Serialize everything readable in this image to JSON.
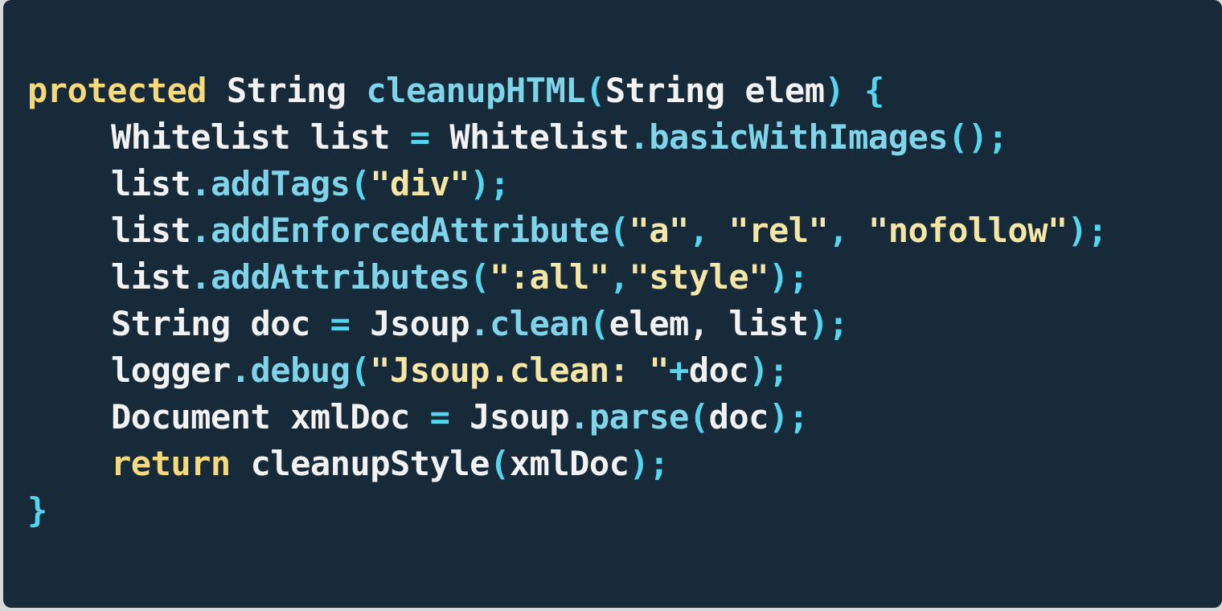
{
  "lines": [
    {
      "indent": false,
      "tokens": [
        {
          "t": "protected",
          "c": "kw"
        },
        {
          "t": " String ",
          "c": "plain"
        },
        {
          "t": "cleanupHTML",
          "c": "fn"
        },
        {
          "t": "(",
          "c": "punc"
        },
        {
          "t": "String elem",
          "c": "plain"
        },
        {
          "t": ") {",
          "c": "punc"
        }
      ]
    },
    {
      "indent": true,
      "tokens": [
        {
          "t": "Whitelist list ",
          "c": "plain"
        },
        {
          "t": "=",
          "c": "op"
        },
        {
          "t": " Whitelist",
          "c": "plain"
        },
        {
          "t": ".basicWithImages",
          "c": "fn"
        },
        {
          "t": "();",
          "c": "punc"
        }
      ]
    },
    {
      "indent": true,
      "tokens": [
        {
          "t": "list",
          "c": "plain"
        },
        {
          "t": ".addTags",
          "c": "fn"
        },
        {
          "t": "(",
          "c": "punc"
        },
        {
          "t": "\"div\"",
          "c": "str"
        },
        {
          "t": ");",
          "c": "punc"
        }
      ]
    },
    {
      "indent": true,
      "tokens": [
        {
          "t": "list",
          "c": "plain"
        },
        {
          "t": ".addEnforcedAttribute",
          "c": "fn"
        },
        {
          "t": "(",
          "c": "punc"
        },
        {
          "t": "\"a\"",
          "c": "str"
        },
        {
          "t": ", ",
          "c": "punc"
        },
        {
          "t": "\"rel\"",
          "c": "str"
        },
        {
          "t": ", ",
          "c": "punc"
        },
        {
          "t": "\"nofollow\"",
          "c": "str"
        },
        {
          "t": ");",
          "c": "punc"
        }
      ]
    },
    {
      "indent": true,
      "tokens": [
        {
          "t": "list",
          "c": "plain"
        },
        {
          "t": ".addAttributes",
          "c": "fn"
        },
        {
          "t": "(",
          "c": "punc"
        },
        {
          "t": "\":all\"",
          "c": "str"
        },
        {
          "t": ",",
          "c": "punc"
        },
        {
          "t": "\"style\"",
          "c": "str"
        },
        {
          "t": ");",
          "c": "punc"
        }
      ]
    },
    {
      "indent": true,
      "tokens": [
        {
          "t": "String doc ",
          "c": "plain"
        },
        {
          "t": "=",
          "c": "op"
        },
        {
          "t": " Jsoup",
          "c": "plain"
        },
        {
          "t": ".clean",
          "c": "fn"
        },
        {
          "t": "(",
          "c": "punc"
        },
        {
          "t": "elem, list",
          "c": "plain"
        },
        {
          "t": ");",
          "c": "punc"
        }
      ]
    },
    {
      "indent": true,
      "tokens": [
        {
          "t": "logger",
          "c": "plain"
        },
        {
          "t": ".debug",
          "c": "fn"
        },
        {
          "t": "(",
          "c": "punc"
        },
        {
          "t": "\"Jsoup.clean: \"",
          "c": "str"
        },
        {
          "t": "+",
          "c": "op"
        },
        {
          "t": "doc",
          "c": "plain"
        },
        {
          "t": ");",
          "c": "punc"
        }
      ]
    },
    {
      "indent": true,
      "tokens": [
        {
          "t": "Document xmlDoc ",
          "c": "plain"
        },
        {
          "t": "=",
          "c": "op"
        },
        {
          "t": " Jsoup",
          "c": "plain"
        },
        {
          "t": ".parse",
          "c": "fn"
        },
        {
          "t": "(",
          "c": "punc"
        },
        {
          "t": "doc",
          "c": "plain"
        },
        {
          "t": ");",
          "c": "punc"
        }
      ]
    },
    {
      "indent": true,
      "tokens": [
        {
          "t": "return",
          "c": "kw"
        },
        {
          "t": " cleanupStyle",
          "c": "plain"
        },
        {
          "t": "(",
          "c": "punc"
        },
        {
          "t": "xmlDoc",
          "c": "plain"
        },
        {
          "t": ");",
          "c": "punc"
        }
      ]
    },
    {
      "indent": false,
      "tokens": [
        {
          "t": "}",
          "c": "punc"
        }
      ]
    }
  ]
}
